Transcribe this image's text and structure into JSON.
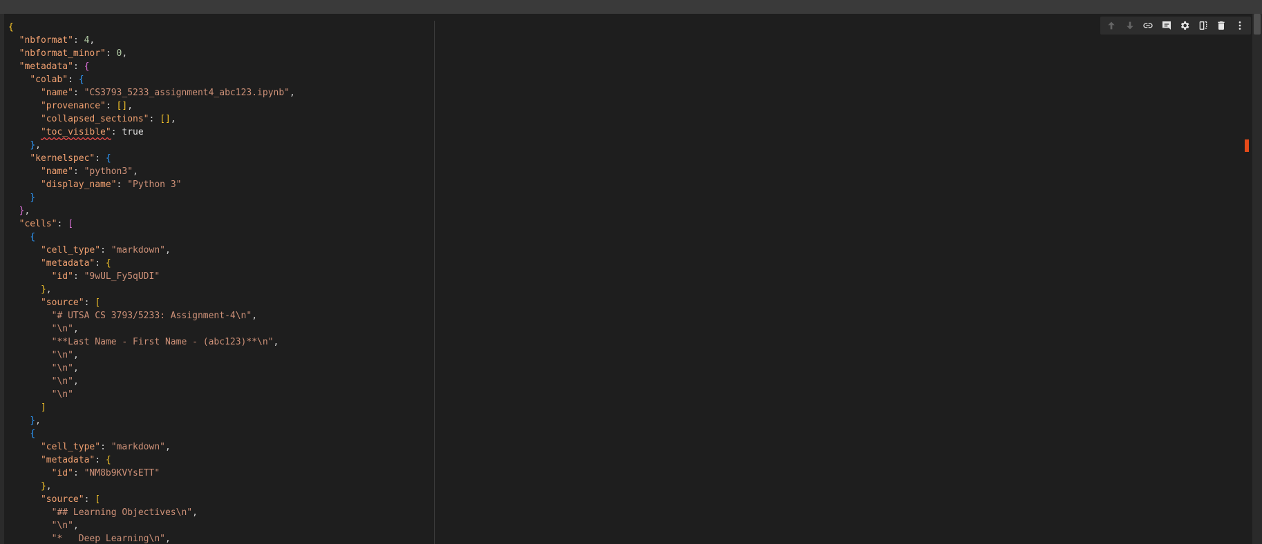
{
  "toolbar": {
    "buttons": [
      {
        "name": "move-up",
        "icon": "arrow-up-icon",
        "enabled": false
      },
      {
        "name": "move-down",
        "icon": "arrow-down-icon",
        "enabled": false
      },
      {
        "name": "link",
        "icon": "link-icon",
        "enabled": true
      },
      {
        "name": "comment",
        "icon": "comment-icon",
        "enabled": true
      },
      {
        "name": "settings",
        "icon": "gear-icon",
        "enabled": true
      },
      {
        "name": "mirror",
        "icon": "mirror-icon",
        "enabled": true
      },
      {
        "name": "delete",
        "icon": "trash-icon",
        "enabled": true
      },
      {
        "name": "more",
        "icon": "more-vert-icon",
        "enabled": true
      }
    ]
  },
  "colors": {
    "background": "#1e1e1e",
    "brace": "#f7c52a",
    "brace2": "#da70d6",
    "brace3": "#2e9bff",
    "string": "#ce9178",
    "number": "#b5cea8",
    "error_marker": "#e54a19"
  },
  "code": {
    "lines": [
      [
        {
          "t": "{",
          "c": "brace"
        }
      ],
      [
        {
          "t": "  "
        },
        {
          "t": "\"nbformat\"",
          "c": "key"
        },
        {
          "t": ": "
        },
        {
          "t": "4",
          "c": "num"
        },
        {
          "t": ","
        }
      ],
      [
        {
          "t": "  "
        },
        {
          "t": "\"nbformat_minor\"",
          "c": "key"
        },
        {
          "t": ": "
        },
        {
          "t": "0",
          "c": "num"
        },
        {
          "t": ","
        }
      ],
      [
        {
          "t": "  "
        },
        {
          "t": "\"metadata\"",
          "c": "key"
        },
        {
          "t": ": "
        },
        {
          "t": "{",
          "c": "brace2"
        }
      ],
      [
        {
          "t": "    "
        },
        {
          "t": "\"colab\"",
          "c": "key"
        },
        {
          "t": ": "
        },
        {
          "t": "{",
          "c": "brace3"
        }
      ],
      [
        {
          "t": "      "
        },
        {
          "t": "\"name\"",
          "c": "key"
        },
        {
          "t": ": "
        },
        {
          "t": "\"CS3793_5233_assignment4_abc123.ipynb\"",
          "c": "str"
        },
        {
          "t": ","
        }
      ],
      [
        {
          "t": "      "
        },
        {
          "t": "\"provenance\"",
          "c": "key"
        },
        {
          "t": ": "
        },
        {
          "t": "[]",
          "c": "brace"
        },
        {
          "t": ","
        }
      ],
      [
        {
          "t": "      "
        },
        {
          "t": "\"collapsed_sections\"",
          "c": "key"
        },
        {
          "t": ": "
        },
        {
          "t": "[]",
          "c": "brace"
        },
        {
          "t": ","
        }
      ],
      [
        {
          "t": "      "
        },
        {
          "t": "\"toc_visible\"",
          "c": "key",
          "squig": true
        },
        {
          "t": ": "
        },
        {
          "t": "true",
          "c": "bool"
        }
      ],
      [
        {
          "t": "    "
        },
        {
          "t": "}",
          "c": "brace3"
        },
        {
          "t": ","
        }
      ],
      [
        {
          "t": "    "
        },
        {
          "t": "\"kernelspec\"",
          "c": "key"
        },
        {
          "t": ": "
        },
        {
          "t": "{",
          "c": "brace3"
        }
      ],
      [
        {
          "t": "      "
        },
        {
          "t": "\"name\"",
          "c": "key"
        },
        {
          "t": ": "
        },
        {
          "t": "\"python3\"",
          "c": "str"
        },
        {
          "t": ","
        }
      ],
      [
        {
          "t": "      "
        },
        {
          "t": "\"display_name\"",
          "c": "key"
        },
        {
          "t": ": "
        },
        {
          "t": "\"Python 3\"",
          "c": "str"
        }
      ],
      [
        {
          "t": "    "
        },
        {
          "t": "}",
          "c": "brace3"
        }
      ],
      [
        {
          "t": "  "
        },
        {
          "t": "}",
          "c": "brace2"
        },
        {
          "t": ","
        }
      ],
      [
        {
          "t": "  "
        },
        {
          "t": "\"cells\"",
          "c": "key"
        },
        {
          "t": ": "
        },
        {
          "t": "[",
          "c": "brace2"
        }
      ],
      [
        {
          "t": "    "
        },
        {
          "t": "{",
          "c": "brace3"
        }
      ],
      [
        {
          "t": "      "
        },
        {
          "t": "\"cell_type\"",
          "c": "key"
        },
        {
          "t": ": "
        },
        {
          "t": "\"markdown\"",
          "c": "str"
        },
        {
          "t": ","
        }
      ],
      [
        {
          "t": "      "
        },
        {
          "t": "\"metadata\"",
          "c": "key"
        },
        {
          "t": ": "
        },
        {
          "t": "{",
          "c": "brace"
        }
      ],
      [
        {
          "t": "        "
        },
        {
          "t": "\"id\"",
          "c": "key"
        },
        {
          "t": ": "
        },
        {
          "t": "\"9wUL_Fy5qUDI\"",
          "c": "str"
        }
      ],
      [
        {
          "t": "      "
        },
        {
          "t": "}",
          "c": "brace"
        },
        {
          "t": ","
        }
      ],
      [
        {
          "t": "      "
        },
        {
          "t": "\"source\"",
          "c": "key"
        },
        {
          "t": ": "
        },
        {
          "t": "[",
          "c": "brace"
        }
      ],
      [
        {
          "t": "        "
        },
        {
          "t": "\"# UTSA CS 3793/5233: Assignment-4\\n\"",
          "c": "str"
        },
        {
          "t": ","
        }
      ],
      [
        {
          "t": "        "
        },
        {
          "t": "\"\\n\"",
          "c": "str"
        },
        {
          "t": ","
        }
      ],
      [
        {
          "t": "        "
        },
        {
          "t": "\"**Last Name - First Name - (abc123)**\\n\"",
          "c": "str"
        },
        {
          "t": ","
        }
      ],
      [
        {
          "t": "        "
        },
        {
          "t": "\"\\n\"",
          "c": "str"
        },
        {
          "t": ","
        }
      ],
      [
        {
          "t": "        "
        },
        {
          "t": "\"\\n\"",
          "c": "str"
        },
        {
          "t": ","
        }
      ],
      [
        {
          "t": "        "
        },
        {
          "t": "\"\\n\"",
          "c": "str"
        },
        {
          "t": ","
        }
      ],
      [
        {
          "t": "        "
        },
        {
          "t": "\"\\n\"",
          "c": "str"
        }
      ],
      [
        {
          "t": "      "
        },
        {
          "t": "]",
          "c": "brace"
        }
      ],
      [
        {
          "t": "    "
        },
        {
          "t": "}",
          "c": "brace3"
        },
        {
          "t": ","
        }
      ],
      [
        {
          "t": "    "
        },
        {
          "t": "{",
          "c": "brace3"
        }
      ],
      [
        {
          "t": "      "
        },
        {
          "t": "\"cell_type\"",
          "c": "key"
        },
        {
          "t": ": "
        },
        {
          "t": "\"markdown\"",
          "c": "str"
        },
        {
          "t": ","
        }
      ],
      [
        {
          "t": "      "
        },
        {
          "t": "\"metadata\"",
          "c": "key"
        },
        {
          "t": ": "
        },
        {
          "t": "{",
          "c": "brace"
        }
      ],
      [
        {
          "t": "        "
        },
        {
          "t": "\"id\"",
          "c": "key"
        },
        {
          "t": ": "
        },
        {
          "t": "\"NM8b9KVYsETT\"",
          "c": "str"
        }
      ],
      [
        {
          "t": "      "
        },
        {
          "t": "}",
          "c": "brace"
        },
        {
          "t": ","
        }
      ],
      [
        {
          "t": "      "
        },
        {
          "t": "\"source\"",
          "c": "key"
        },
        {
          "t": ": "
        },
        {
          "t": "[",
          "c": "brace"
        }
      ],
      [
        {
          "t": "        "
        },
        {
          "t": "\"## Learning Objectives\\n\"",
          "c": "str"
        },
        {
          "t": ","
        }
      ],
      [
        {
          "t": "        "
        },
        {
          "t": "\"\\n\"",
          "c": "str"
        },
        {
          "t": ","
        }
      ],
      [
        {
          "t": "        "
        },
        {
          "t": "\"*   Deep Learning\\n\"",
          "c": "str"
        },
        {
          "t": ","
        }
      ]
    ]
  }
}
